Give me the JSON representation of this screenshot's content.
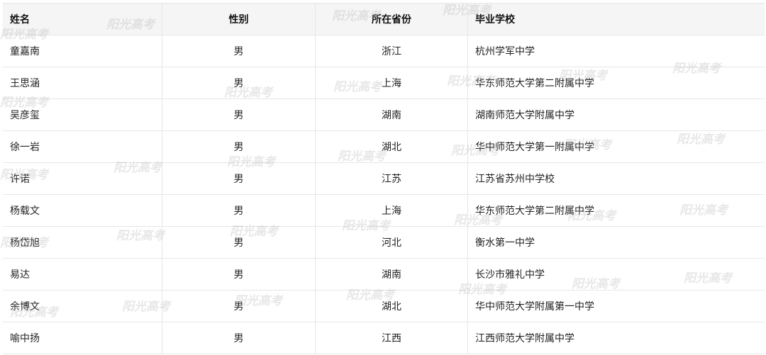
{
  "table": {
    "headers": {
      "name": "姓名",
      "gender": "性别",
      "province": "所在省份",
      "school": "毕业学校"
    },
    "rows": [
      {
        "name": "童嘉南",
        "gender": "男",
        "province": "浙江",
        "school": "杭州学军中学"
      },
      {
        "name": "王思涵",
        "gender": "男",
        "province": "上海",
        "school": "华东师范大学第二附属中学"
      },
      {
        "name": "吴彦玺",
        "gender": "男",
        "province": "湖南",
        "school": "湖南师范大学附属中学"
      },
      {
        "name": "徐一岩",
        "gender": "男",
        "province": "湖北",
        "school": "华中师范大学第一附属中学"
      },
      {
        "name": "许诺",
        "gender": "男",
        "province": "江苏",
        "school": "江苏省苏州中学校"
      },
      {
        "name": "杨载文",
        "gender": "男",
        "province": "上海",
        "school": "华东师范大学第二附属中学"
      },
      {
        "name": "杨岱旭",
        "gender": "男",
        "province": "河北",
        "school": "衡水第一中学"
      },
      {
        "name": "易达",
        "gender": "男",
        "province": "湖南",
        "school": "长沙市雅礼中学"
      },
      {
        "name": "余博文",
        "gender": "男",
        "province": "湖北",
        "school": "华中师范大学附属第一中学"
      },
      {
        "name": "喻中扬",
        "gender": "男",
        "province": "江西",
        "school": "江西师范大学附属中学"
      }
    ]
  },
  "watermark": {
    "text": "阳光高考"
  }
}
